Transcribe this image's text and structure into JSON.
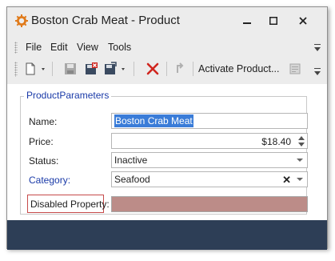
{
  "window": {
    "title": "Boston Crab Meat - Product"
  },
  "titlebar": {
    "icons": [
      "gear-icon",
      "minimize-icon",
      "maximize-icon",
      "close-icon"
    ]
  },
  "menu": {
    "items": [
      "File",
      "Edit",
      "View",
      "Tools"
    ]
  },
  "toolbar": {
    "activate_label": "Activate Product...",
    "icons": [
      "new-document-icon",
      "save-icon",
      "save-and-close-icon",
      "save-options-icon",
      "delete-icon",
      "undo-icon",
      "disabled-document-icon"
    ],
    "colors": {
      "delete": "#d0261f"
    }
  },
  "form": {
    "group_caption": "ProductParameters",
    "name": {
      "label": "Name:",
      "value": "Boston Crab Meat"
    },
    "price": {
      "label": "Price:",
      "value": "$18.40"
    },
    "status": {
      "label": "Status:",
      "value": "Inactive"
    },
    "category": {
      "label": "Category:",
      "value": "Seafood"
    },
    "disabled": {
      "label": "Disabled Property:",
      "value": ""
    }
  },
  "colors": {
    "accent_blue": "#1a3aa8",
    "selection": "#3a7cd8",
    "disabled_field": "#bc8c88",
    "status_bar": "#2d3e56"
  }
}
